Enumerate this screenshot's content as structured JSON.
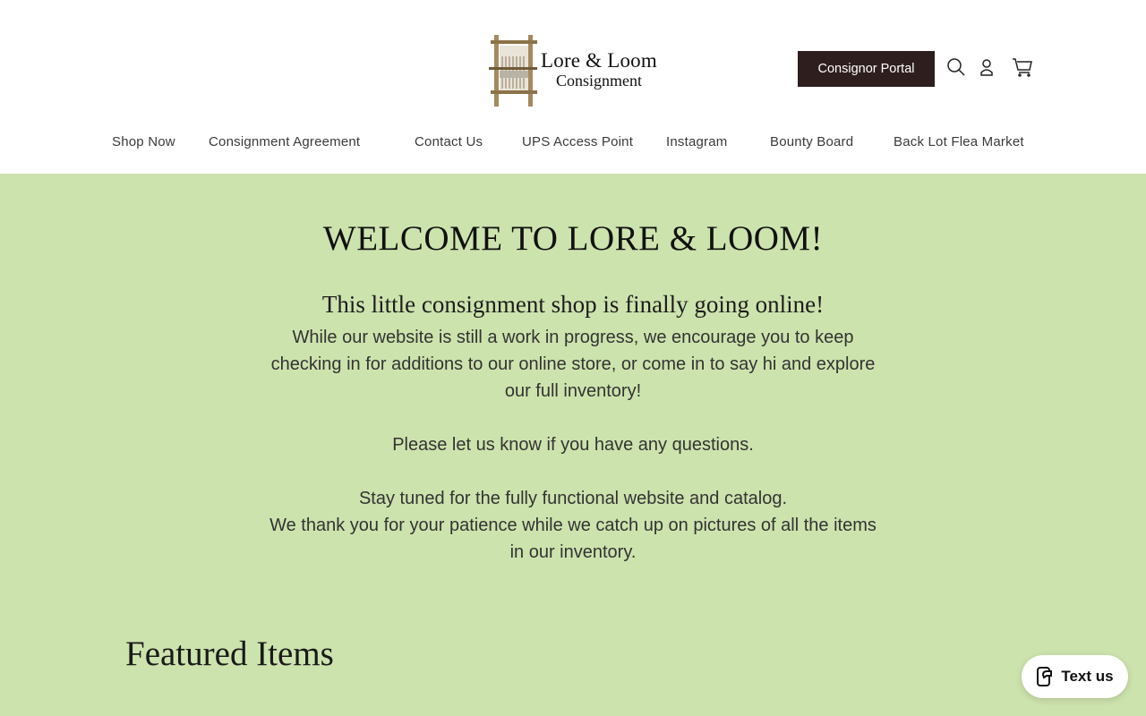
{
  "brand": {
    "line1": "Lore & Loom",
    "line2": "Consignment",
    "logo_icon": "loom-icon"
  },
  "header": {
    "portal_label": "Consignor Portal",
    "icons": [
      "search-icon",
      "account-icon",
      "cart-icon"
    ]
  },
  "nav": {
    "items": [
      "Shop Now",
      "Consignment Agreement",
      "Contact Us",
      "UPS Access Point",
      "Instagram",
      "Bounty Board",
      "Back Lot Flea Market"
    ]
  },
  "welcome": {
    "title": "WELCOME TO LORE & LOOM!",
    "intro": "This little consignment shop is finally going online!",
    "paragraph1": "While our website is still a work in progress, we encourage you to keep checking in for additions to our online store, or come in to say hi and explore our full inventory!",
    "paragraph2": "Please let us know if you have any questions.",
    "paragraph3_line1": "Stay tuned for the fully functional website and catalog.",
    "paragraph3_line2": "We thank you for your patience while we catch up on pictures of all the items in our inventory."
  },
  "featured": {
    "title": "Featured Items"
  },
  "chat": {
    "label": "Text us",
    "icon": "chat-phone-icon"
  },
  "colors": {
    "background": "#cde3ad",
    "header": "#ffffff",
    "portal_button": "#2f1e1e"
  }
}
